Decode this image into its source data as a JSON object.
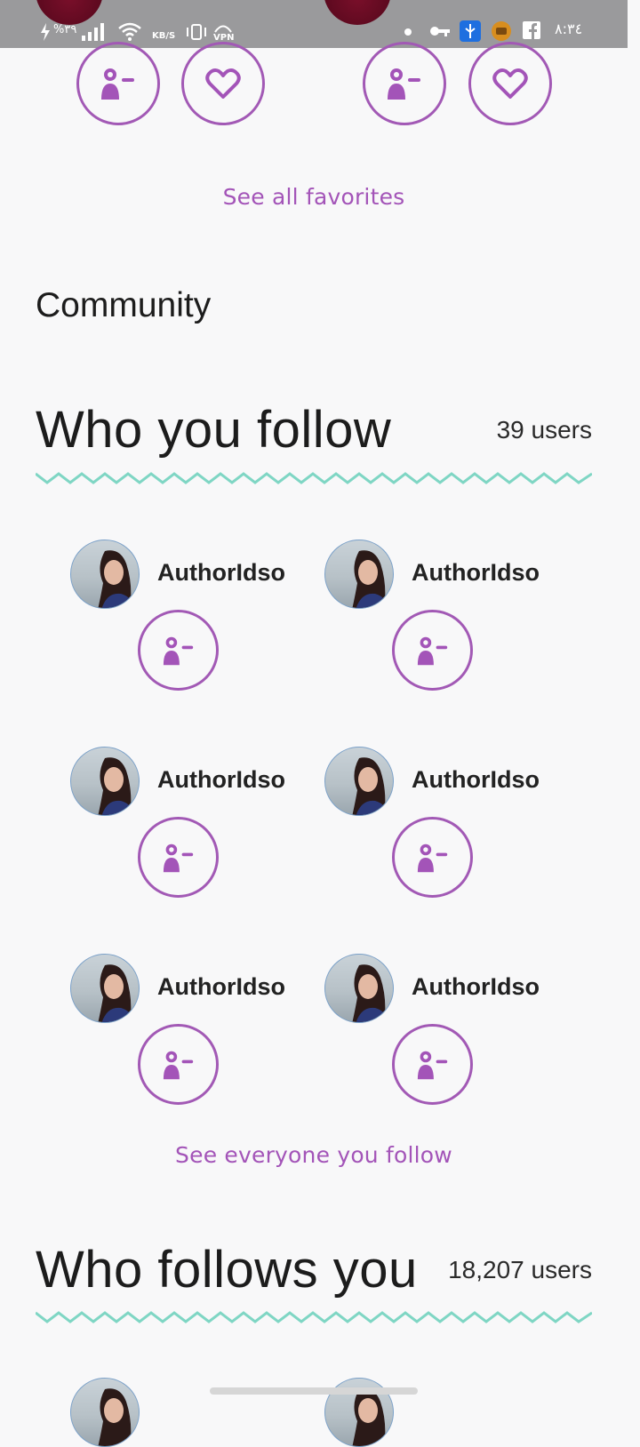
{
  "status_bar": {
    "battery": "%٣٩",
    "speed_unit": "KB/S",
    "vpn": "VPN",
    "time": "٨:٣٤"
  },
  "favorites": {
    "see_all_label": "See all favorites"
  },
  "community": {
    "heading": "Community"
  },
  "who_you_follow": {
    "title": "Who you follow",
    "count": "39 users",
    "users": [
      {
        "name": "AuthorIdso"
      },
      {
        "name": "AuthorIdso"
      },
      {
        "name": "AuthorIdso"
      },
      {
        "name": "AuthorIdso"
      },
      {
        "name": "AuthorIdso"
      },
      {
        "name": "AuthorIdso"
      }
    ],
    "see_all_label": "See everyone you follow"
  },
  "who_follows_you": {
    "title": "Who follows you",
    "count": "18,207 users"
  },
  "icons": {
    "unfollow": "person-remove-icon",
    "favorite": "heart-icon"
  },
  "colors": {
    "accent": "#a259b5",
    "zigzag": "#7fd6c4",
    "status_bar": "#9a9a9c",
    "background": "#f8f8f9"
  }
}
